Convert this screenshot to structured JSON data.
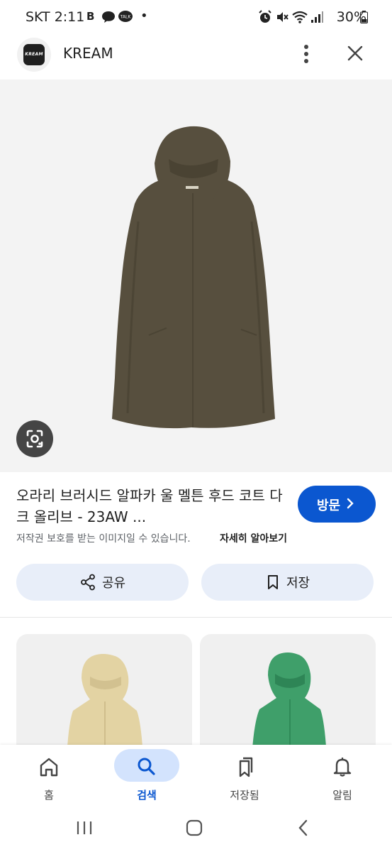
{
  "status_bar": {
    "time": "SKT 2:11",
    "note_b": "B",
    "talk": "TALK",
    "battery": "30%"
  },
  "header": {
    "logo_text": "KREAM",
    "site_name": "KREAM"
  },
  "product": {
    "title": "오라리 브러시드 알파카 울 멜튼 후드 코트 다크 올리브 - 23AW ...",
    "visit_label": "방문",
    "copyright_notice": "저작권 보호를 받는 이미지일 수 있습니다.",
    "learn_more": "자세히 알아보기",
    "coat_color": "#574f3e"
  },
  "actions": {
    "share_label": "공유",
    "save_label": "저장"
  },
  "related": [
    {
      "coat_color": "#e3d3a3"
    },
    {
      "coat_color": "#3f9f6a"
    }
  ],
  "bottom_nav": {
    "home": "홈",
    "search": "검색",
    "saved": "저장됨",
    "notifications": "알림"
  },
  "colors": {
    "accent": "#0b57d0",
    "active_pill": "#d3e3fd",
    "action_pill": "#e8eef9"
  }
}
